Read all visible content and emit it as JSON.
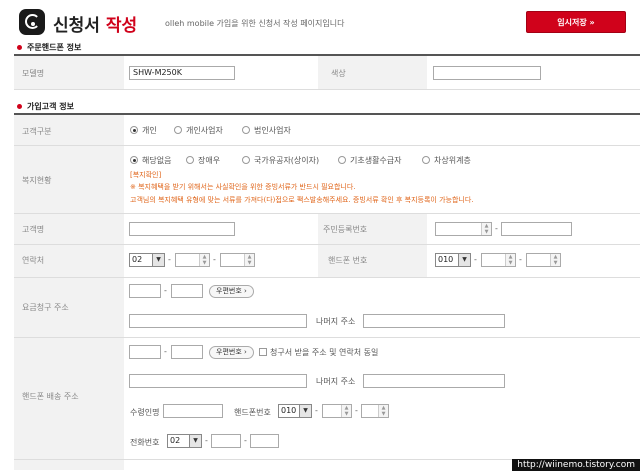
{
  "header": {
    "title_part1": "신청서",
    "title_part2": "작성",
    "subtitle": "olleh mobile 가입을 위한 신청서 작성 페이지입니다",
    "save_button": "임시저장 »"
  },
  "phone_section": {
    "title": "주문핸드폰 정보",
    "model_label": "모델명",
    "model_value": "SHW-M250K",
    "color_label": "색상",
    "color_value": ""
  },
  "customer_section": {
    "title": "가입고객 정보",
    "customer_type_label": "고객구분",
    "customer_types": [
      "개인",
      "개인사업자",
      "법인사업자"
    ],
    "welfare_label": "복지현황",
    "welfare_options": [
      "해당없음",
      "장애우",
      "국가유공자(상이자)",
      "기초생활수급자",
      "차상위계층"
    ],
    "welfare_link": "[복지확인]",
    "welfare_note1": "※ 복지혜택을 받기 위해서는 사실확인을 위한 증빙서류가 반드시 필요합니다.",
    "welfare_note2": "고객님의 복지혜택 유형에 맞는 서류를 가져다(다)접으로 팩스발송해주세요. 증빙서류 확인 후 복지등록이 가능합니다.",
    "name_label": "고객명",
    "name_value": "",
    "rrn_label": "주민등록번호",
    "contact_label": "연락처",
    "contact_area": "02",
    "mobile_label": "핸드폰 번호",
    "mobile_prefix": "010",
    "billing_label": "요금청구 주소",
    "zip_button": "우편번호 ›",
    "rest_address_label": "나머지 주소",
    "delivery_label": "핸드폰 배송 주소",
    "same_as_billing": "청구서 받을 주소 및 연락처 동일",
    "recipient_label": "수령인명",
    "delivery_mobile_label": "핸드폰번호",
    "delivery_mobile_prefix": "010",
    "phone_label": "전화번호",
    "phone_area": "02"
  },
  "footer": {
    "url": "http://wiinemo.tistory.com"
  },
  "colors": {
    "accent": "#d0021b",
    "note": "#e0661b"
  }
}
